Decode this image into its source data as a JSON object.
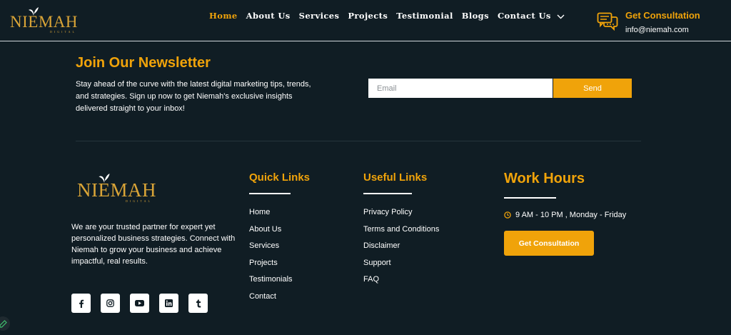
{
  "brand": {
    "name": "NIEMAH",
    "tagline": "DIGITAL"
  },
  "nav": {
    "items": [
      {
        "label": "Home",
        "active": true
      },
      {
        "label": "About Us",
        "active": false
      },
      {
        "label": "Services",
        "active": false
      },
      {
        "label": "Projects",
        "active": false
      },
      {
        "label": "Testimonial",
        "active": false
      },
      {
        "label": "Blogs",
        "active": false
      },
      {
        "label": "Contact Us",
        "active": false
      }
    ]
  },
  "header_cta": {
    "title": "Get Consultation",
    "email": "info@niemah.com"
  },
  "newsletter": {
    "title": "Join Our Newsletter",
    "text": "Stay ahead of the curve with the latest digital marketing tips, trends, and strategies. Sign up now to get Niemah's exclusive insights delivered straight to your inbox!",
    "email_placeholder": "Email",
    "email_value": "",
    "send_label": "Send"
  },
  "footer": {
    "brand_text": "We are your trusted partner for expert yet personalized business strategies. Connect with Niemah to grow your business and achieve impactful, real results.",
    "socials": [
      "facebook-icon",
      "instagram-icon",
      "youtube-icon",
      "linkedin-icon",
      "tumblr-icon"
    ],
    "quick_links": {
      "title": "Quick Links",
      "items": [
        "Home",
        "About Us",
        "Services",
        "Projects",
        "Testimonials",
        "Contact"
      ]
    },
    "useful_links": {
      "title": "Useful Links",
      "items": [
        "Privacy Policy",
        "Terms and Conditions",
        "Disclaimer",
        "Support",
        "FAQ"
      ]
    },
    "work_hours": {
      "title": "Work Hours",
      "hours": "9 AM - 10 PM , Monday - Friday",
      "button_label": "Get Consultation"
    }
  },
  "colors": {
    "accent": "#f0a30a",
    "background": "#101d24",
    "logo_gold": "#d9a437"
  }
}
